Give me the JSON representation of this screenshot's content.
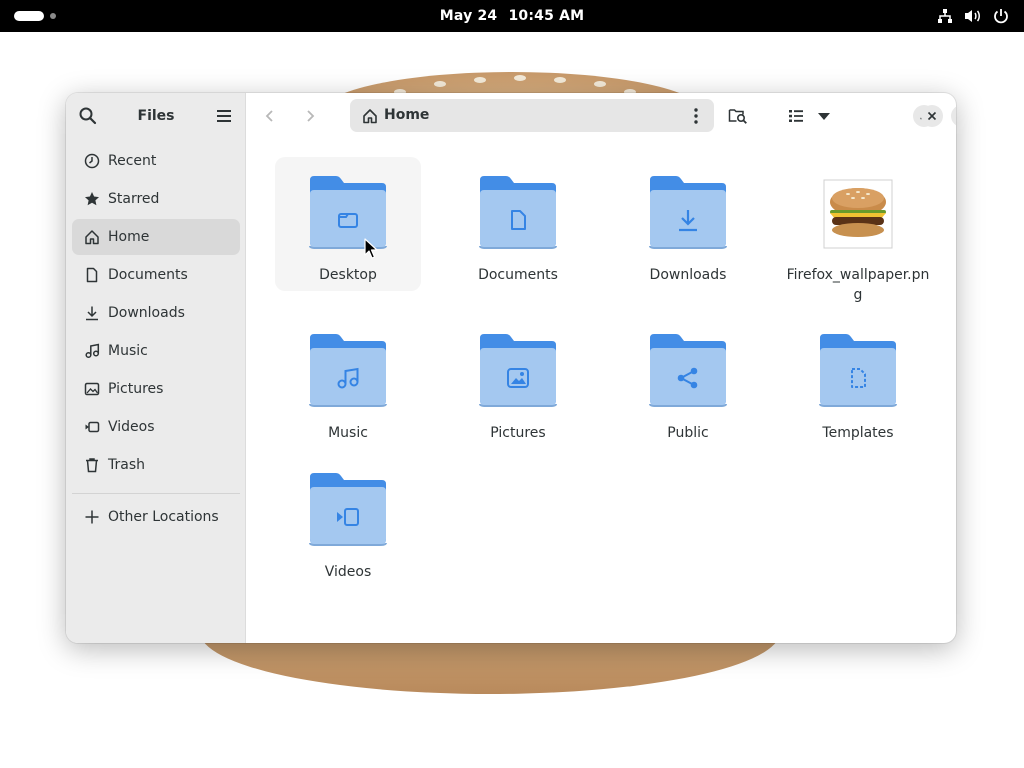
{
  "topbar": {
    "date": "May 24",
    "time": "10:45 AM",
    "tray_icons": [
      "network-icon",
      "volume-icon",
      "power-icon"
    ]
  },
  "sidebar": {
    "title": "Files",
    "places": [
      {
        "label": "Recent",
        "icon": "clock-icon"
      },
      {
        "label": "Starred",
        "icon": "star-icon"
      },
      {
        "label": "Home",
        "icon": "home-icon",
        "active": true
      },
      {
        "label": "Documents",
        "icon": "document-icon"
      },
      {
        "label": "Downloads",
        "icon": "download-icon"
      },
      {
        "label": "Music",
        "icon": "music-icon"
      },
      {
        "label": "Pictures",
        "icon": "picture-icon"
      },
      {
        "label": "Videos",
        "icon": "video-icon"
      },
      {
        "label": "Trash",
        "icon": "trash-icon"
      }
    ],
    "other_locations": "Other Locations"
  },
  "pathbar": {
    "location": "Home"
  },
  "items": [
    {
      "name": "Desktop",
      "type": "folder",
      "emblem": "folder"
    },
    {
      "name": "Documents",
      "type": "folder",
      "emblem": "document"
    },
    {
      "name": "Downloads",
      "type": "folder",
      "emblem": "download"
    },
    {
      "name": "Firefox_wallpaper.png",
      "type": "image"
    },
    {
      "name": "Music",
      "type": "folder",
      "emblem": "music"
    },
    {
      "name": "Pictures",
      "type": "folder",
      "emblem": "picture"
    },
    {
      "name": "Public",
      "type": "folder",
      "emblem": "share"
    },
    {
      "name": "Templates",
      "type": "folder",
      "emblem": "template"
    },
    {
      "name": "Videos",
      "type": "folder",
      "emblem": "video"
    }
  ],
  "colors": {
    "folder_back": "#438de6",
    "folder_front": "#a4c8f0",
    "folder_emblem": "#3584e4",
    "topbar": "#000000",
    "sidebar": "#ebebeb"
  }
}
